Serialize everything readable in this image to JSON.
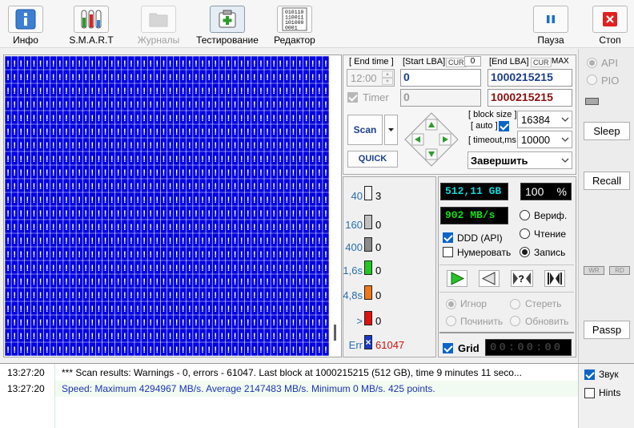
{
  "toolbar": {
    "items": [
      {
        "label": "Инфо",
        "icon": "info-icon"
      },
      {
        "label": "S.M.A.R.T",
        "icon": "smart-icon"
      },
      {
        "label": "Журналы",
        "icon": "journals-icon"
      },
      {
        "label": "Тестирование",
        "icon": "testing-icon"
      },
      {
        "label": "Редактор",
        "icon": "editor-icon"
      },
      {
        "label": "Пауза",
        "icon": "pause-icon"
      },
      {
        "label": "Стоп",
        "icon": "stop-icon"
      }
    ],
    "editor_bits": [
      "010110",
      "110011",
      "101000",
      "0001"
    ]
  },
  "controls": {
    "end_time_label": "[ End time ]",
    "end_time_value": "12:00",
    "timer_label": "Timer",
    "start_lba_label": "[Start LBA]",
    "cur_label": "CUR",
    "start_cur_value": "0",
    "start_lba_value": "0",
    "timer_value": "0",
    "end_lba_label": "[End LBA]",
    "max_label": "MAX",
    "end_lba_value": "1000215215",
    "end_lba_value2": "1000215215",
    "scan_label": "Scan",
    "quick_label": "QUICK",
    "block_size_label": "[ block size ]",
    "auto_label": "[ auto ]",
    "block_size_value": "16384",
    "timeout_label": "[ timeout,ms ]",
    "timeout_value": "10000",
    "finish_value": "Завершить"
  },
  "stats": {
    "size_value": "512,11 GB",
    "percent_value": "100",
    "percent_unit": "%",
    "speed_value": "902 MB/s",
    "verify_label": "Вериф.",
    "read_label": "Чтение",
    "write_label": "Запись",
    "ddd_label": "DDD (API)",
    "numerate_label": "Нумеровать",
    "ignore_label": "Игнор",
    "erase_label": "Стереть",
    "repair_label": "Починить",
    "refresh_label": "Обновить",
    "grid_label": "Grid",
    "grid_time": "00:00:00"
  },
  "legend": [
    {
      "label": "40",
      "count": "3",
      "color": "#f4f4f4"
    },
    {
      "label": "160",
      "count": "0",
      "color": "#c0c0c0"
    },
    {
      "label": "400",
      "count": "0",
      "color": "#8a8a8a"
    },
    {
      "label": "1,6s",
      "count": "0",
      "color": "#22c822"
    },
    {
      "label": "4,8s",
      "count": "0",
      "color": "#f07818"
    },
    {
      "label": ">",
      "count": "0",
      "color": "#e01010"
    },
    {
      "label": "Err",
      "count": "61047",
      "color": "#1838c8"
    }
  ],
  "side": {
    "api_label": "API",
    "pio_label": "PIO",
    "sleep_label": "Sleep",
    "recall_label": "Recall",
    "wr_label": "WR",
    "rd_label": "RD",
    "passp_label": "Passp",
    "sound_label": "Звук",
    "hints_label": "Hints"
  },
  "log": [
    {
      "time": "13:27:20",
      "text": "*** Scan results: Warnings - 0, errors - 61047. Last block at 1000215215 (512 GB), time 9 minutes 11 seco...",
      "color": "#000000"
    },
    {
      "time": "13:27:20",
      "text": "Speed: Maximum 4294967 MB/s. Average 2147483 MB/s. Minimum 0 MB/s. 425 points.",
      "color": "#1a34b4"
    }
  ],
  "map": {
    "cell_glyph": "!"
  }
}
